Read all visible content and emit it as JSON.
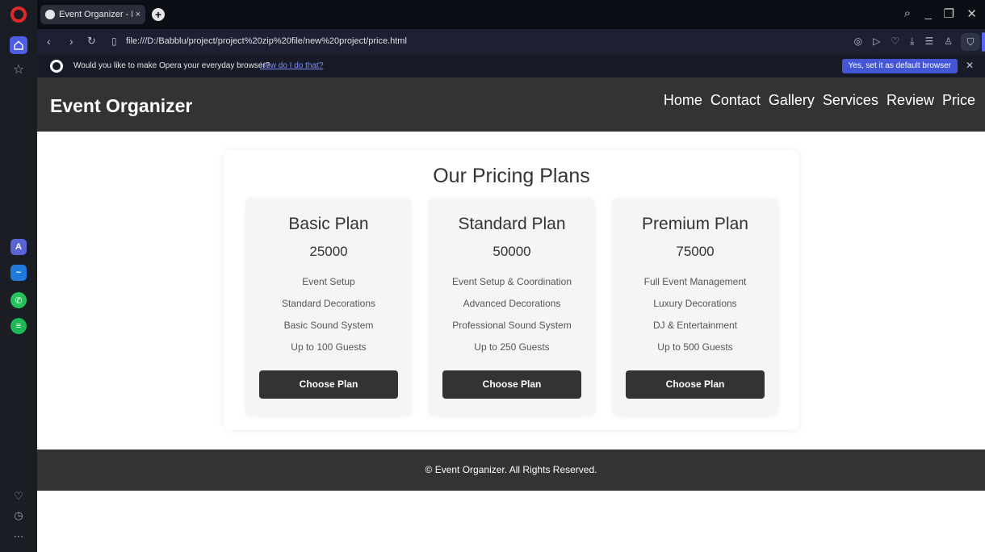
{
  "browser": {
    "tab_title": "Event Organizer - Pric",
    "url": "file:///D:/Babblu/project/project%20zip%20file/new%20project/price.html",
    "infobar": {
      "message": "Would you like to make Opera your everyday browser?",
      "link": "How do I do that?",
      "button": "Yes, set it as default browser"
    },
    "accent_color": "#4d5ee6"
  },
  "site": {
    "brand": "Event Organizer",
    "nav": [
      "Home",
      "Contact",
      "Gallery",
      "Services",
      "Review",
      "Price"
    ],
    "header_color": "#333333"
  },
  "pricing": {
    "title": "Our Pricing Plans",
    "plans": [
      {
        "name": "Basic Plan",
        "price": "25000",
        "features": [
          "Event Setup",
          "Standard Decorations",
          "Basic Sound System",
          "Up to 100 Guests"
        ],
        "button": "Choose Plan"
      },
      {
        "name": "Standard Plan",
        "price": "50000",
        "features": [
          "Event Setup & Coordination",
          "Advanced Decorations",
          "Professional Sound System",
          "Up to 250 Guests"
        ],
        "button": "Choose Plan"
      },
      {
        "name": "Premium Plan",
        "price": "75000",
        "features": [
          "Full Event Management",
          "Luxury Decorations",
          "DJ & Entertainment",
          "Up to 500 Guests"
        ],
        "button": "Choose Plan"
      }
    ]
  },
  "footer": {
    "text": "© Event Organizer. All Rights Reserved."
  }
}
